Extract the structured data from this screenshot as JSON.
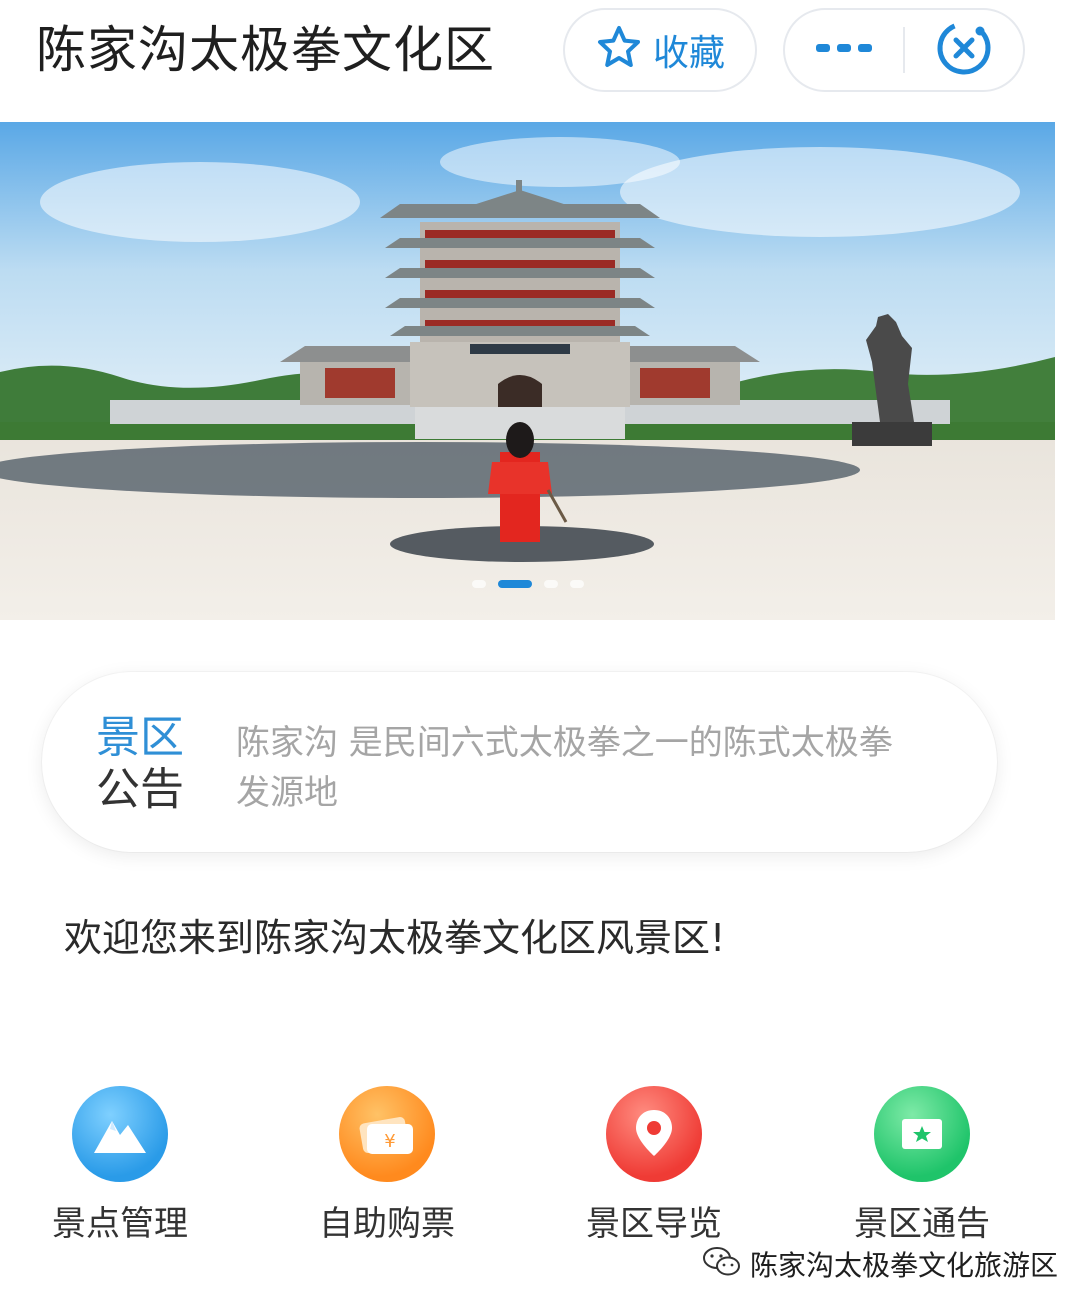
{
  "header": {
    "title": "陈家沟太极拳文化区",
    "favorite_icon": "star-icon",
    "favorite_label": "收藏",
    "more_icon": "more-dots-icon",
    "close_icon": "close-circle-icon"
  },
  "banner": {
    "slide_count": 4,
    "active_slide": 2
  },
  "notice": {
    "tag_line1": "景区",
    "tag_line2": "公告",
    "text": "陈家沟 是民间六式太极拳之一的陈式太极拳发源地"
  },
  "welcome": "欢迎您来到陈家沟太极拳文化区风景区!",
  "functions": [
    {
      "label": "景点管理",
      "icon": "mountain-icon",
      "color": "#2a9be8"
    },
    {
      "label": "自助购票",
      "icon": "ticket-icon",
      "color": "#ff8a1e"
    },
    {
      "label": "景区导览",
      "icon": "location-pin-icon",
      "color": "#ef3b35"
    },
    {
      "label": "景区通告",
      "icon": "notice-board-icon",
      "color": "#1fc46a"
    }
  ],
  "watermark": {
    "icon": "wechat-icon",
    "text": "陈家沟太极拳文化旅游区"
  },
  "colors": {
    "accent": "#1f88d8",
    "notice_text": "#a5a5a5"
  }
}
